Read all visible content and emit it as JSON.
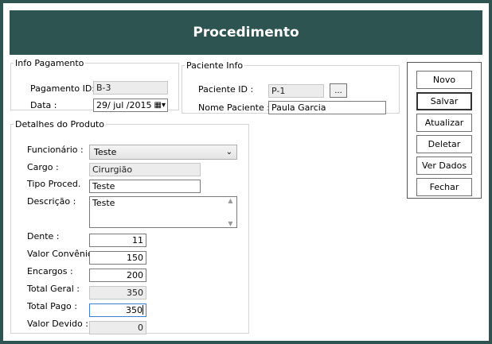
{
  "window": {
    "title": "Procedimento"
  },
  "info_pagamento": {
    "legend": "Info Pagamento",
    "pagamento_id_label": "Pagamento ID:",
    "pagamento_id_value": "B-3",
    "data_label": "Data :",
    "data_value": "29/ jul /2015"
  },
  "paciente_info": {
    "legend": "Paciente Info",
    "paciente_id_label": "Paciente ID :",
    "paciente_id_value": "P-1",
    "browse_label": "...",
    "nome_label": "Nome Paciente :",
    "nome_value": "Paula Garcia"
  },
  "detalhes": {
    "legend": "Detalhes do Produto",
    "funcionario_label": "Funcionário :",
    "funcionario_value": "Teste",
    "cargo_label": "Cargo :",
    "cargo_value": "Cirurgião",
    "tipo_label": "Tipo Proced.",
    "tipo_value": "Teste",
    "descricao_label": "Descrição :",
    "descricao_value": "Teste",
    "dente_label": "Dente :",
    "dente_value": "11",
    "valor_convenio_label": "Valor Convênio :",
    "valor_convenio_value": "150",
    "encargos_label": "Encargos :",
    "encargos_value": "200",
    "total_geral_label": "Total Geral :",
    "total_geral_value": "350",
    "total_pago_label": "Total Pago :",
    "total_pago_value": "350",
    "valor_devido_label": "Valor Devido :",
    "valor_devido_value": "0"
  },
  "actions": {
    "novo": "Novo",
    "salvar": "Salvar",
    "atualizar": "Atualizar",
    "deletar": "Deletar",
    "ver_dados": "Ver Dados",
    "fechar": "Fechar"
  }
}
